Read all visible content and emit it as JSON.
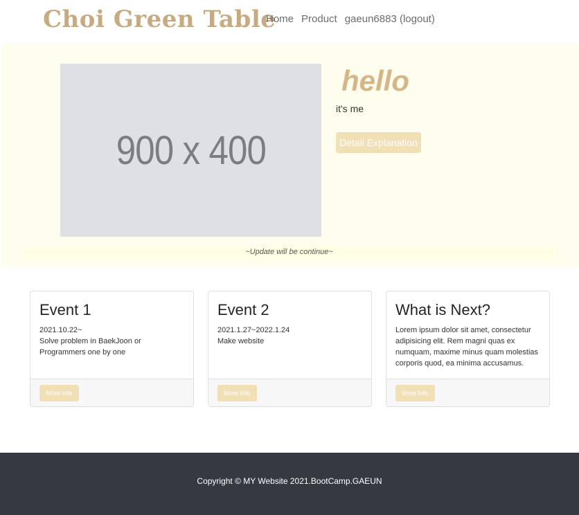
{
  "navbar": {
    "brand": "Choi Green Table",
    "links": [
      {
        "label": "Home"
      },
      {
        "label": "Product"
      },
      {
        "label": "gaeun6883 (logout)"
      }
    ]
  },
  "hero": {
    "image_text": "900 x 400",
    "title": "hello",
    "subtitle": "it's me",
    "button_label": "Detail Explanation",
    "update_note": "~Update will be continue~"
  },
  "cards": [
    {
      "title": "Event 1",
      "lines": [
        "2021.10.22~",
        "Solve problem in BaekJoon or Programmers one by one"
      ],
      "button_label": "More Info"
    },
    {
      "title": "Event 2",
      "lines": [
        "2021.1.27~2022.1.24",
        "Make website"
      ],
      "button_label": "More Info"
    },
    {
      "title": "What is Next?",
      "lines": [
        "Lorem ipsum dolor sit amet, consectetur adipisicing elit. Rem magni quas ex numquam, maxime minus quam molestias corporis quod, ea minima accusamus."
      ],
      "button_label": "More Info"
    }
  ],
  "footer": {
    "copyright": "Copyright © MY Website 2021.BootCamp.GAEUN"
  },
  "colors": {
    "brand": "#c8aa80",
    "hero_bg": "#fffeee",
    "accent_button": "#f1dfb5",
    "footer_bg": "#343a40"
  }
}
